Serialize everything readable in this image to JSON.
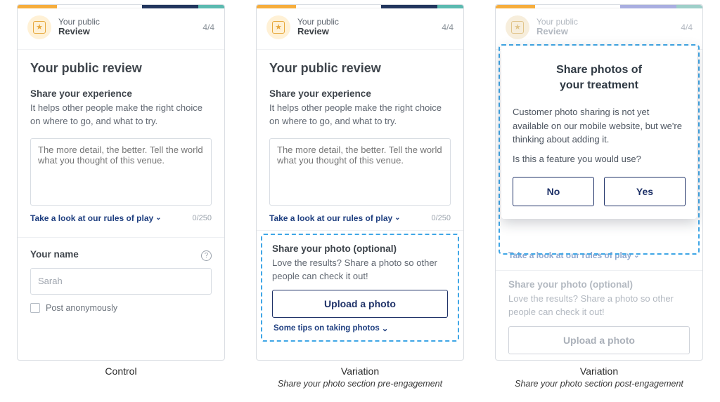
{
  "header": {
    "line1": "Your public",
    "line2": "Review",
    "step": "4/4",
    "icon_glyph": "★"
  },
  "review": {
    "title": "Your public review",
    "subhead": "Share your experience",
    "desc": "It helps other people make the right choice on where to go, and what to try.",
    "placeholder": "The more detail, the better. Tell the world what you thought of this venue.",
    "rules_link": "Take a look at our rules of play",
    "counter": "0/250"
  },
  "name_section": {
    "label": "Your name",
    "value": "Sarah",
    "anon": "Post anonymously"
  },
  "photo_section": {
    "subhead": "Share your photo (optional)",
    "desc": "Love the results? Share a photo so other people can check it out!",
    "button": "Upload a photo",
    "tips": "Some tips on taking photos"
  },
  "overlay": {
    "title_l1": "Share photos of",
    "title_l2": "your treatment",
    "body": "Customer photo sharing is not yet available on our mobile website, but we're thinking about adding it.",
    "question": "Is this a feature you would use?",
    "no": "No",
    "yes": "Yes"
  },
  "captions": {
    "c1": "Control",
    "c2_main": "Variation",
    "c2_sub": "Share your photo section pre-engagement",
    "c3_main": "Variation",
    "c3_sub": "Share your photo section post-engagement"
  }
}
